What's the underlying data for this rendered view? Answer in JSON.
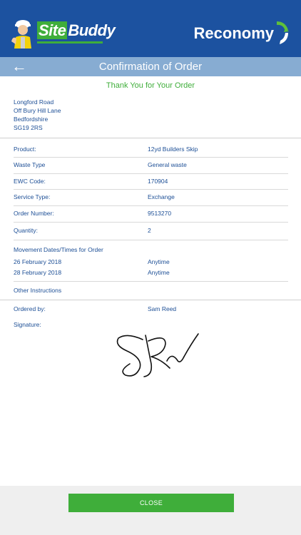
{
  "header": {
    "logo_left": {
      "part1": "Site",
      "part2": "Buddy"
    },
    "logo_right": "Reconomy"
  },
  "titlebar": {
    "back_icon": "←",
    "title": "Confirmation of Order"
  },
  "thanks": "Thank You for Your Order",
  "address": [
    "Longford Road",
    "Off Bury Hill Lane",
    "Bedfordshire",
    "SG19 2RS"
  ],
  "details": [
    {
      "label": "Product:",
      "value": "12yd Builders Skip"
    },
    {
      "label": "Waste Type",
      "value": "General waste"
    },
    {
      "label": "EWC Code:",
      "value": "170904"
    },
    {
      "label": "Service Type:",
      "value": "Exchange"
    },
    {
      "label": "Order Number:",
      "value": "9513270"
    },
    {
      "label": "Quantity:",
      "value": "2"
    }
  ],
  "movement": {
    "heading": "Movement Dates/Times for Order",
    "entries": [
      {
        "date": "26 February 2018",
        "time": "Anytime"
      },
      {
        "date": "28 February 2018",
        "time": "Anytime"
      }
    ]
  },
  "other_instructions": "Other Instructions",
  "ordered_by": {
    "label": "Ordered by:",
    "value": "Sam Reed"
  },
  "signature_label": "Signature:",
  "footer": {
    "close_label": "CLOSE"
  },
  "colors": {
    "header_blue": "#1c52a0",
    "titlebar_blue": "#87acd2",
    "text_blue": "#1d4f96",
    "accent_green": "#3fae3a"
  }
}
